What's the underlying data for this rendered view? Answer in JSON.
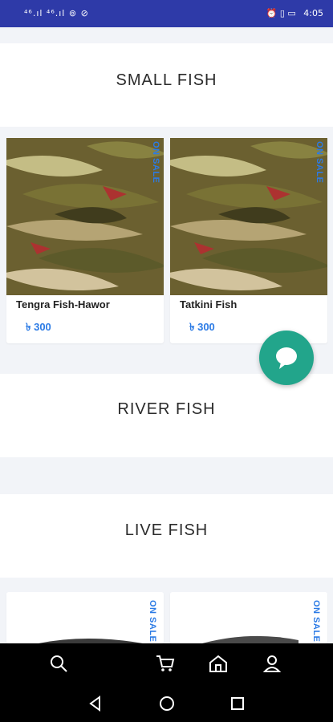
{
  "status_bar": {
    "left_indicators": "⁴⁶.ıl ⁴⁶.ıl ⊚ ⊘",
    "right_indicators": "⏰ ▯ ▭",
    "time": "4:05"
  },
  "sections": [
    {
      "title": "SMALL FISH",
      "products": [
        {
          "name": "Tengra Fish-Hawor",
          "price": "৳ 300",
          "badge": "ON SALE"
        },
        {
          "name": "Tatkini Fish",
          "price": "৳ 300",
          "badge": "ON SALE"
        }
      ]
    },
    {
      "title": "RIVER FISH",
      "products": []
    },
    {
      "title": "LIVE FISH",
      "products": [
        {
          "name": "",
          "price": "",
          "badge": "ON SALE"
        },
        {
          "name": "",
          "price": "",
          "badge": "ON SALE"
        }
      ]
    }
  ],
  "chat_button": {
    "icon": "chat-bubble-icon"
  },
  "bottom_nav": {
    "items": [
      {
        "icon": "search-icon"
      },
      {
        "icon": "cart-icon"
      },
      {
        "icon": "home-icon"
      },
      {
        "icon": "profile-icon"
      }
    ]
  },
  "system_nav": [
    "back-icon",
    "home-circle-icon",
    "recents-icon"
  ],
  "colors": {
    "status_bar": "#2e3aa8",
    "accent_blue": "#2c7be5",
    "fab_green": "#22a58b",
    "nav_background": "#000000"
  }
}
